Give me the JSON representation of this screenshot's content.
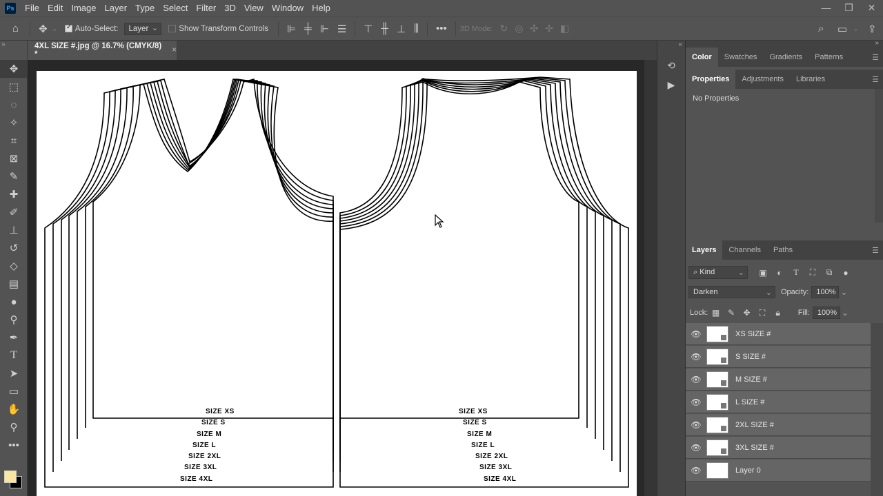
{
  "app": {
    "logo": "Ps",
    "menu": [
      "File",
      "Edit",
      "Image",
      "Layer",
      "Type",
      "Select",
      "Filter",
      "3D",
      "View",
      "Window",
      "Help"
    ],
    "window_controls": [
      "—",
      "❐",
      "✕"
    ]
  },
  "options": {
    "auto_select_label": "Auto-Select:",
    "auto_select_target": "Layer",
    "transform_controls_label": "Show Transform Controls",
    "more": "•••",
    "mode_3d_label": "3D Mode:"
  },
  "document": {
    "tab_title": "4XL SIZE #.jpg @ 16.7% (CMYK/8) *",
    "close": "×"
  },
  "canvas": {
    "left_sizes": [
      "SIZE  XS",
      "SIZE  S",
      "SIZE  M",
      "SIZE  L",
      "SIZE  2XL",
      "SIZE  3XL",
      "SIZE  4XL"
    ],
    "right_sizes": [
      "SIZE  XS",
      "SIZE  S",
      "SIZE  M",
      "SIZE  L",
      "SIZE  2XL",
      "SIZE  3XL",
      "SIZE  4XL"
    ]
  },
  "color_panel": {
    "tabs": [
      "Color",
      "Swatches",
      "Gradients",
      "Patterns"
    ]
  },
  "properties_panel": {
    "tabs": [
      "Properties",
      "Adjustments",
      "Libraries"
    ],
    "empty_text": "No Properties"
  },
  "layers_panel": {
    "tabs": [
      "Layers",
      "Channels",
      "Paths"
    ],
    "filter_kind": "Kind",
    "blend_mode": "Darken",
    "opacity_label": "Opacity:",
    "opacity_value": "100%",
    "lock_label": "Lock:",
    "fill_label": "Fill:",
    "fill_value": "100%",
    "layers": [
      {
        "name": "XS SIZE #",
        "selected": true
      },
      {
        "name": "S SIZE #",
        "selected": true
      },
      {
        "name": "M SIZE #",
        "selected": true
      },
      {
        "name": "L SIZE #",
        "selected": true
      },
      {
        "name": "2XL SIZE #",
        "selected": true
      },
      {
        "name": "3XL SIZE #",
        "selected": true
      },
      {
        "name": "Layer 0",
        "selected": true
      }
    ]
  },
  "colors": {
    "foreground": "#f9e6a0",
    "background": "#000000"
  }
}
